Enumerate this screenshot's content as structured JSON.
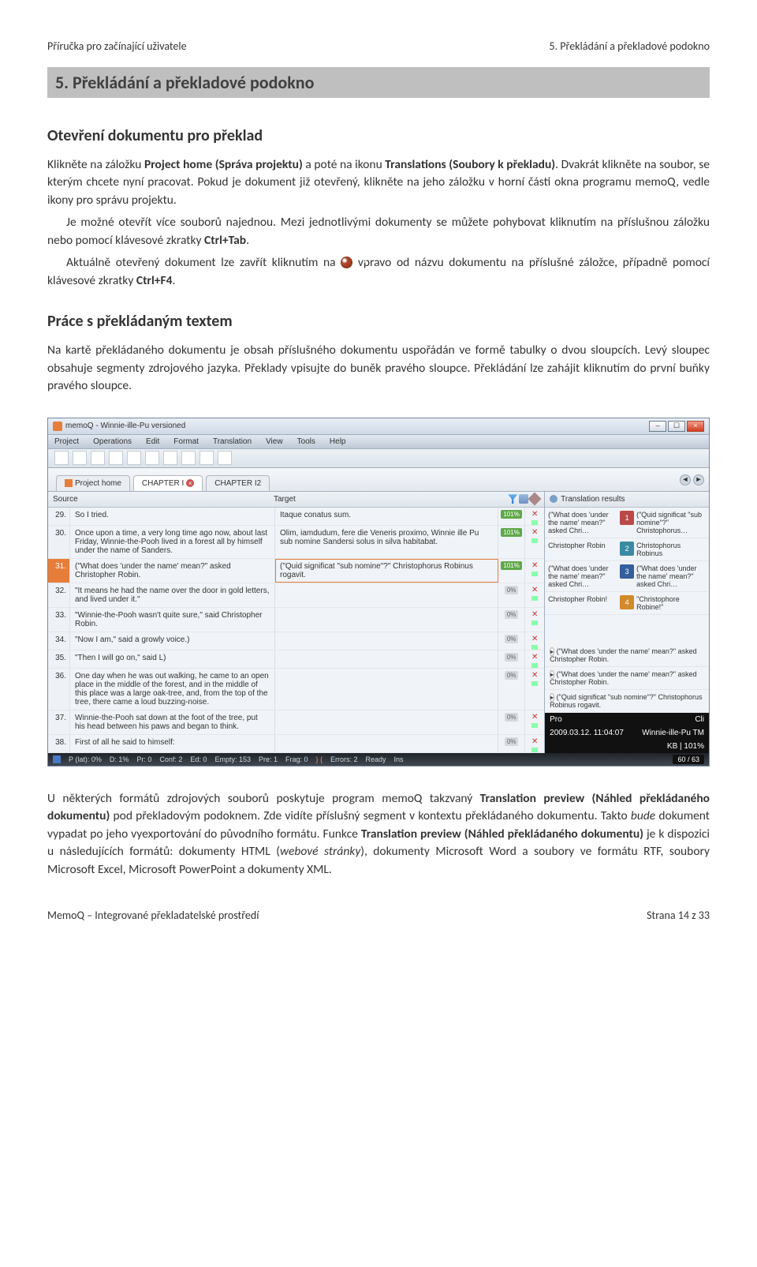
{
  "header": {
    "left": "Příručka pro začínající uživatele",
    "right": "5. Překládání a překladové podokno"
  },
  "section_title": "5. Překládání a překladové podokno",
  "section1": {
    "heading": "Otevření dokumentu pro překlad",
    "p1_a": "Klikněte na záložku ",
    "p1_b": "Project home (Správa projektu)",
    "p1_c": " a poté na ikonu ",
    "p1_d": "Translations (Soubory k překladu)",
    "p1_e": ". Dvakrát klikněte na soubor, se kterým chcete nyní pracovat. Pokud je dokument již otevřený, klikněte na jeho záložku v horní části okna programu memoQ, vedle ikony pro správu projektu.",
    "p2_a": "Je možné otevřít více souborů najednou. Mezi jednotlivými dokumenty se můžete pohybovat kliknutím na příslušnou záložku nebo pomocí klávesové zkratky ",
    "p2_b": "Ctrl+Tab",
    "p2_c": ".",
    "p3_a": "Aktuálně otevřený dokument lze zavřít kliknutím na ",
    "p3_b": " vpravo od názvu dokumentu na příslušné záložce, případně pomocí klávesové zkratky ",
    "p3_c": "Ctrl+F4",
    "p3_d": "."
  },
  "section2": {
    "heading": "Práce s překládaným textem",
    "p1": "Na kartě překládaného dokumentu je obsah příslušného dokumentu uspořádán ve formě tabulky o dvou sloupcích. Levý sloupec obsahuje segmenty zdrojového jazyka. Překlady vpisujte do buněk pravého sloupce. Překládání lze zahájit kliknutím do první buňky pravého sloupce."
  },
  "screenshot": {
    "title": "memoQ - Winnie-ille-Pu versioned",
    "menu": [
      "Project",
      "Operations",
      "Edit",
      "Format",
      "Translation",
      "View",
      "Tools",
      "Help"
    ],
    "tabs": {
      "home": "Project home",
      "active": "CHAPTER I",
      "other": "CHAPTER I2"
    },
    "source_label": "Source",
    "target_label": "Target",
    "results_label": "Translation results",
    "rows": [
      {
        "n": "29.",
        "src": "So I tried.",
        "tgt": "Itaque conatus sum.",
        "pct": "101%",
        "x": true
      },
      {
        "n": "30.",
        "src": "Once upon a time, a very long time ago now, about last Friday, Winnie-the-Pooh lived in a forest all by himself under the name of Sanders.",
        "tgt": "Olim, iamdudum, fere die Veneris proximo, Winnie ille Pu sub nomine Sandersi solus in silva habitabat.",
        "pct": "101%",
        "x": true
      },
      {
        "n": "31.",
        "src": "(\"What does 'under the name' mean?\" asked Christopher Robin.",
        "tgt": "(\"Quid significat \"sub nomine\"?\" Christophorus Robinus rogavit.",
        "pct": "101%",
        "x": true,
        "sel": true
      },
      {
        "n": "32.",
        "src": "\"It means he had the name over the door in gold letters, and lived under it.\"",
        "tgt": "",
        "pct": "0%",
        "x": true
      },
      {
        "n": "33.",
        "src": "\"Winnie-the-Pooh wasn't quite sure,\" said Christopher Robin.",
        "tgt": "",
        "pct": "0%",
        "x": true
      },
      {
        "n": "34.",
        "src": "\"Now I am,\" said a growly voice.)",
        "tgt": "",
        "pct": "0%",
        "x": true
      },
      {
        "n": "35.",
        "src": "\"Then I will go on,\" said L)",
        "tgt": "",
        "pct": "0%",
        "x": true
      },
      {
        "n": "36.",
        "src": "One day when he was out walking, he came to an open place in the middle of the forest, and in the middle of this place was a large oak-tree, and, from the top of the tree, there came a loud buzzing-noise.",
        "tgt": "",
        "pct": "0%",
        "x": true
      },
      {
        "n": "37.",
        "src": "Winnie-the-Pooh sat down at the foot of the tree, put his head between his paws and began to think.",
        "tgt": "",
        "pct": "0%",
        "x": true
      },
      {
        "n": "38.",
        "src": "First of all he said to himself:",
        "tgt": "",
        "pct": "0%",
        "x": true
      }
    ],
    "results": [
      {
        "l": "(\"What does 'under the name' mean?\" asked Chri…",
        "r": "(\"Quid significat \"sub nomine\"?\" Christophorus…",
        "chip": "1",
        "c": "red"
      },
      {
        "l": "Christopher Robin",
        "r": "Christophorus Robinus",
        "chip": "2",
        "c": "teal"
      },
      {
        "l": "(\"What does 'under the name' mean?\" asked Chri…",
        "r": "(\"What does 'under the name' mean?\" asked Chri…",
        "chip": "3",
        "c": "blue"
      },
      {
        "l": "Christopher Robin!",
        "r": "\"Christophore Robine!\"",
        "chip": "4",
        "c": "orange"
      }
    ],
    "lower_results": [
      "(\"What does 'under the name' mean?\" asked Christopher Robin.",
      "(\"What does 'under the name' mean?\" asked Christopher Robin.",
      "(\"Quid significat \"sub nomine\"?\" Christophorus Robinus rogavit."
    ],
    "black_row": {
      "l1": "Pro",
      "r1": "Cli",
      "l2": "2009.03.12. 11:04:07",
      "r2": "Winnie-ille-Pu TM",
      "kb": "KB | 101%"
    },
    "statusbar": {
      "items": [
        "P (lat): 0%",
        "D: 1%",
        "Pr: 0",
        "Conf: 2",
        "Ed: 0",
        "Empty: 153",
        "Pre: 1",
        "Frag: 0",
        "Errors: 2",
        "Ready",
        "Ins",
        "60 / 63"
      ]
    }
  },
  "section3": {
    "p1_a": "U některých formátů zdrojových souborů poskytuje program memoQ takzvaný ",
    "p1_b": "Translation preview (Náhled překládaného dokumentu)",
    "p1_c": " pod překladovým podoknem. Zde vidíte příslušný segment v kontextu překládaného dokumentu. Takto ",
    "p1_d": "bude",
    "p1_e": " dokument vypadat po jeho vyexportování do původního formátu. Funkce ",
    "p1_f": "Translation preview (Náhled překládaného dokumentu)",
    "p1_g": " je k dispozici u následujících formátů: dokumenty HTML (",
    "p1_h": "webové stránky",
    "p1_i": "), dokumenty Microsoft Word a soubory ve formátu RTF, soubory Microsoft Excel, Microsoft PowerPoint a dokumenty XML."
  },
  "footer": {
    "left": "MemoQ – Integrované překladatelské prostředí",
    "right": "Strana 14 z 33"
  }
}
